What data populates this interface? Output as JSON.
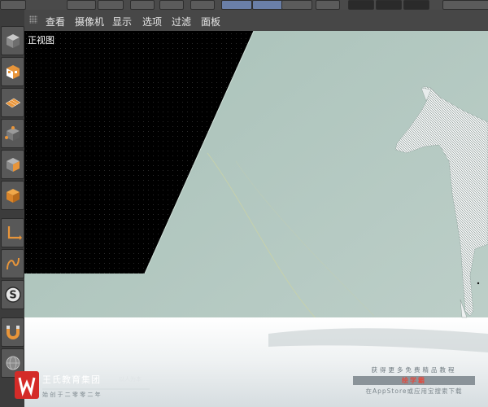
{
  "menu": {
    "items": [
      {
        "label": "查看"
      },
      {
        "label": "摄像机"
      },
      {
        "label": "显示"
      },
      {
        "label": "选项"
      },
      {
        "label": "过滤"
      },
      {
        "label": "面板"
      }
    ]
  },
  "viewport": {
    "label": "正视图",
    "colors": {
      "background": "#b4c9c1",
      "dark_panel": "#000000",
      "floor": "#f2f4f4"
    }
  },
  "toolbar_icons": [
    "cube-icon",
    "checker-cube-icon",
    "grid-plane-icon",
    "spline-point-icon",
    "cube-icon",
    "orange-cube-icon",
    "axis-icon",
    "mouse-icon",
    "s-icon",
    "magnet-icon",
    "sphere-grid-icon"
  ],
  "watermark": {
    "left_title": "王氏教育集团",
    "left_tag": "以人为本",
    "left_sub": "始 创 于 二 零 零 二 年",
    "right_line1": "获得更多免费精品教程",
    "right_line2": "绘学霸",
    "right_line3": "在AppStore或应用宝搜索下载"
  }
}
